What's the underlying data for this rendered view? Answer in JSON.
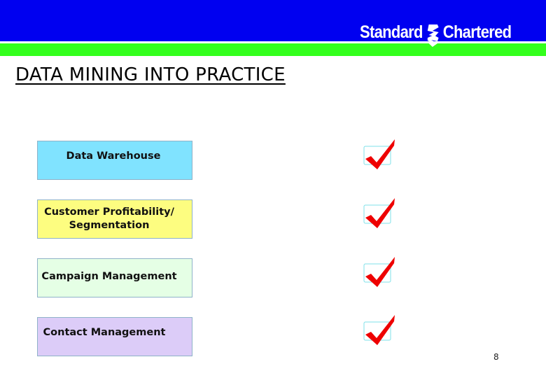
{
  "header": {
    "brand_left": "Standard",
    "brand_right": "Chartered",
    "colors": {
      "top_bar": "#0000f0",
      "accent_bar": "#33ff1c",
      "brand_text": "#ffffff"
    }
  },
  "slide": {
    "title": "DATA MINING INTO PRACTICE",
    "items": [
      {
        "label": "Data Warehouse",
        "color": "#80e3ff",
        "status_icon": "checkmark-icon",
        "checked": true
      },
      {
        "label": "Customer Profitability/ Segmentation",
        "color": "#fdfd80",
        "status_icon": "checkmark-icon",
        "checked": true
      },
      {
        "label": "Campaign Management",
        "color": "#e5ffe5",
        "status_icon": "checkmark-icon",
        "checked": true
      },
      {
        "label": "Contact Management",
        "color": "#dcccf8",
        "status_icon": "checkmark-icon",
        "checked": true
      }
    ],
    "check_color": "#ee0000",
    "page_number": "8"
  }
}
